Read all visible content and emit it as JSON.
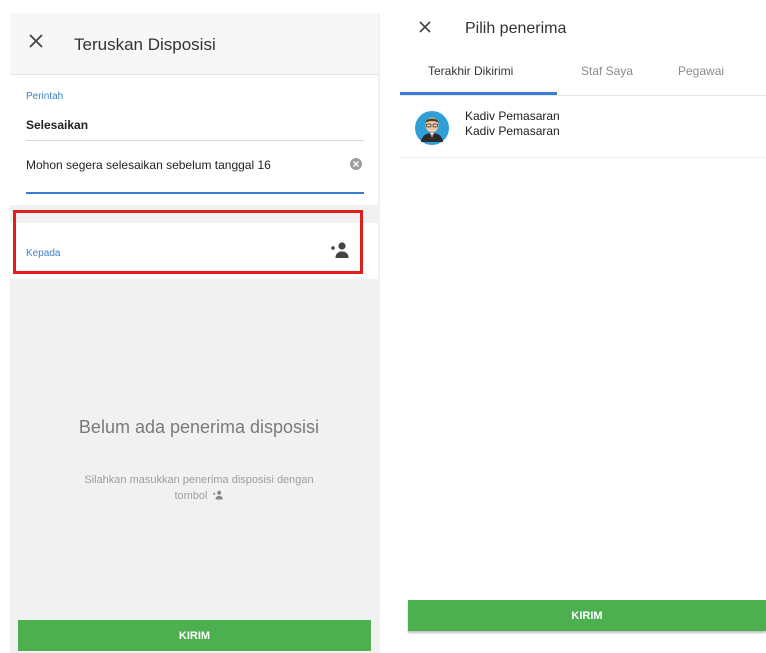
{
  "left_screen": {
    "title": "Teruskan Disposisi",
    "perintah_label": "Perintah",
    "perintah_value": "Selesaikan",
    "message_value": "Mohon segera selesaikan sebelum tanggal 16",
    "kepada_label": "Kepada",
    "empty_title": "Belum ada penerima disposisi",
    "empty_desc_1": "Silahkan masukkan penerima disposisi dengan",
    "empty_desc_2": "tombol",
    "submit_label": "KIRIM"
  },
  "right_screen": {
    "title": "Pilih penerima",
    "tabs": [
      {
        "label": "Terakhir Dikirimi",
        "active": true
      },
      {
        "label": "Staf Saya",
        "active": false
      },
      {
        "label": "Pegawai",
        "active": false
      }
    ],
    "recipients": [
      {
        "name": "Kadiv Pemasaran",
        "position": "Kadiv Pemasaran"
      }
    ],
    "submit_label": "KIRIM"
  },
  "colors": {
    "accent_blue": "#3a7bd5",
    "button_green": "#4caf50",
    "highlight_red": "#e01e1e"
  },
  "icons": {
    "close": "close-icon",
    "clear": "clear-circle-icon",
    "add_person": "person-add-icon",
    "avatar": "user-avatar-icon"
  }
}
